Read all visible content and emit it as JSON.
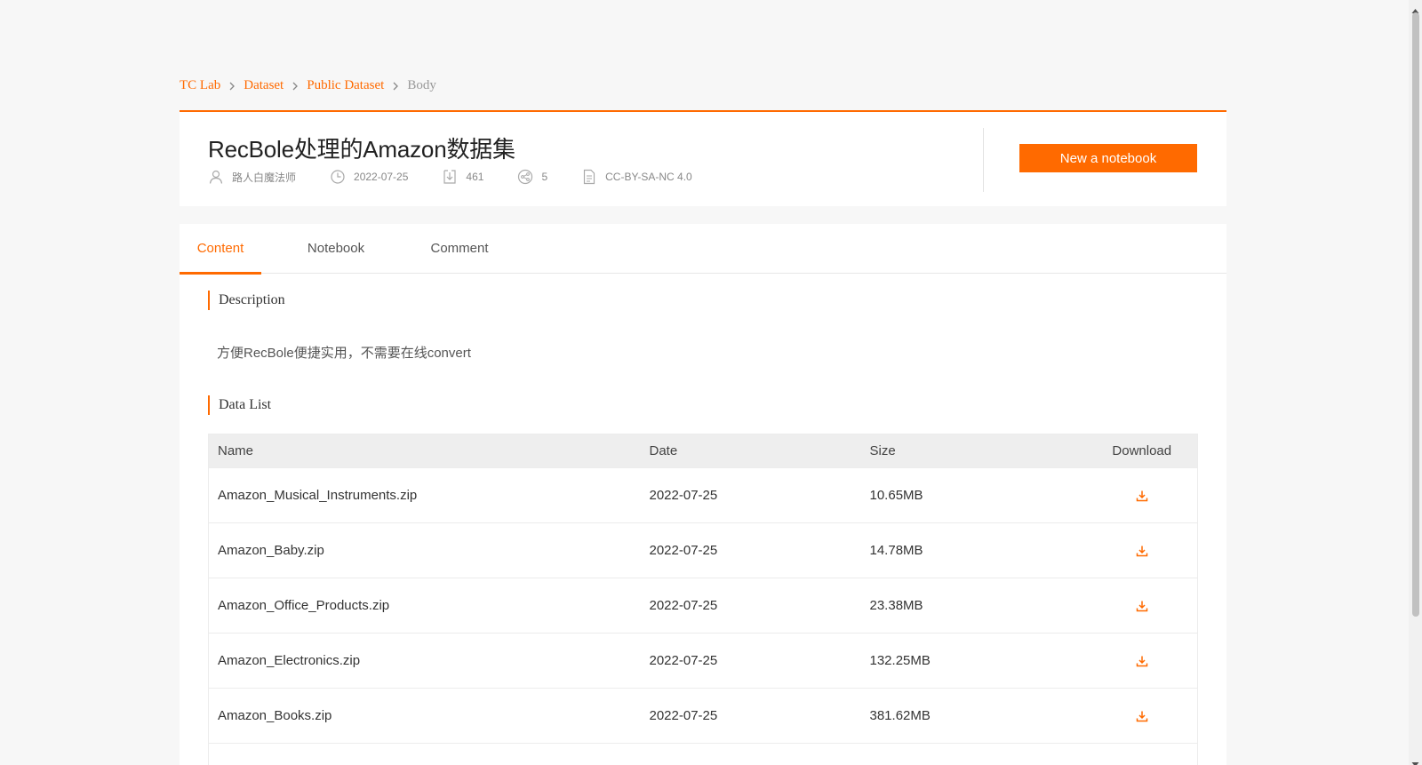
{
  "breadcrumb": {
    "items": [
      "TC Lab",
      "Dataset",
      "Public Dataset"
    ],
    "current": "Body"
  },
  "dataset": {
    "title": "RecBole处理的Amazon数据集",
    "author": "路人白魔法师",
    "date": "2022-07-25",
    "downloads": "461",
    "shares": "5",
    "license": "CC-BY-SA-NC 4.0"
  },
  "actions": {
    "new_notebook": "New a notebook"
  },
  "tabs": [
    {
      "label": "Content",
      "active": true
    },
    {
      "label": "Notebook",
      "active": false
    },
    {
      "label": "Comment",
      "active": false
    }
  ],
  "description": {
    "heading": "Description",
    "text": "方便RecBole便捷实用，不需要在线convert"
  },
  "data_list": {
    "heading": "Data List",
    "columns": [
      "Name",
      "Date",
      "Size",
      "Download"
    ],
    "rows": [
      {
        "name": "Amazon_Musical_Instruments.zip",
        "date": "2022-07-25",
        "size": "10.65MB"
      },
      {
        "name": "Amazon_Baby.zip",
        "date": "2022-07-25",
        "size": "14.78MB"
      },
      {
        "name": "Amazon_Office_Products.zip",
        "date": "2022-07-25",
        "size": "23.38MB"
      },
      {
        "name": "Amazon_Electronics.zip",
        "date": "2022-07-25",
        "size": "132.25MB"
      },
      {
        "name": "Amazon_Books.zip",
        "date": "2022-07-25",
        "size": "381.62MB"
      }
    ]
  },
  "colors": {
    "accent": "#ff6a00",
    "page_bg": "#f7f7f7",
    "header_bg": "#eeeeee"
  },
  "icons": {
    "author": "user-icon",
    "date": "clock-icon",
    "downloads": "download-icon",
    "shares": "share-icon",
    "license": "document-icon",
    "row_download": "download-icon"
  }
}
